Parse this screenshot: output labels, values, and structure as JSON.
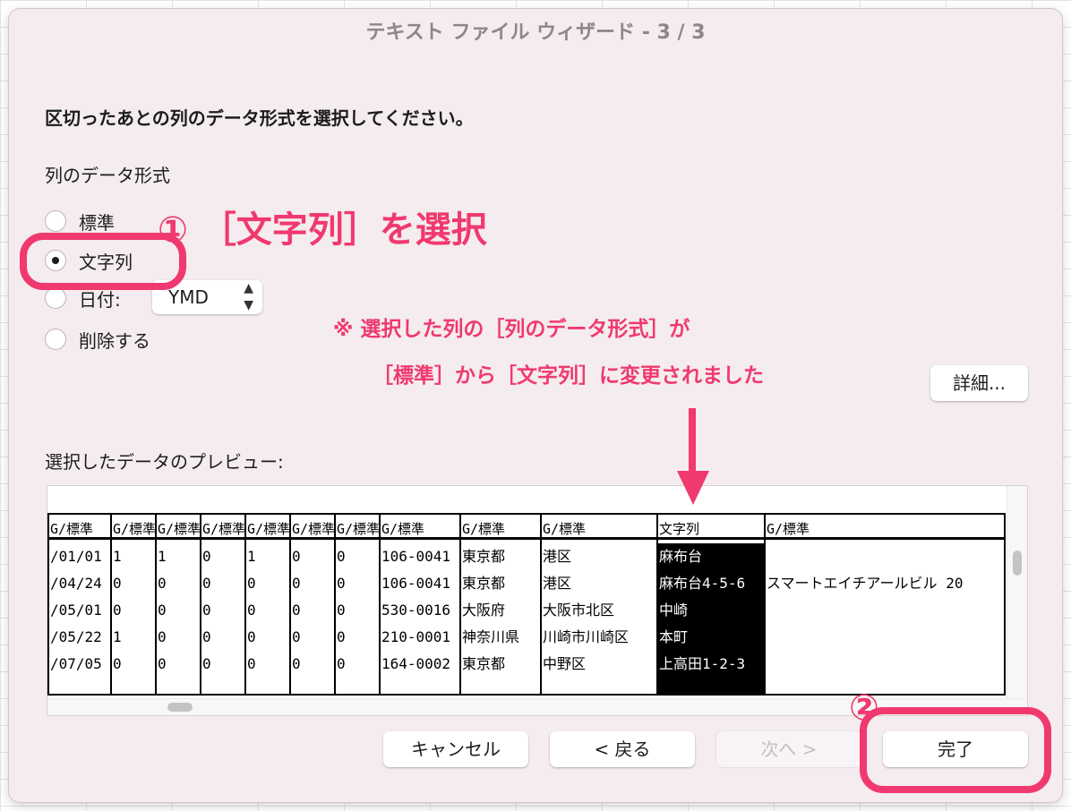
{
  "window": {
    "title": "テキスト ファイル ウィザード - 3 / 3"
  },
  "instruction": "区切ったあとの列のデータ形式を選択してください。",
  "column_format": {
    "label": "列のデータ形式",
    "options": [
      {
        "label": "標準",
        "selected": false
      },
      {
        "label": "文字列",
        "selected": true
      },
      {
        "label": "日付:",
        "selected": false
      },
      {
        "label": "削除する",
        "selected": false
      }
    ],
    "date_format": "YMD"
  },
  "advanced_button": "詳細...",
  "preview": {
    "label": "選択したデータのプレビュー:",
    "headers": [
      "G/標準",
      "G/標準",
      "G/標準",
      "G/標準",
      "G/標準",
      "G/標準",
      "G/標準",
      "G/標準",
      "G/標準",
      "G/標準",
      "文字列",
      "G/標準"
    ],
    "rows": [
      [
        "/01/01",
        "1",
        "1",
        "0",
        "1",
        "0",
        "0",
        "106-0041",
        "東京都",
        "港区",
        "麻布台",
        ""
      ],
      [
        "/04/24",
        "0",
        "0",
        "0",
        "0",
        "0",
        "0",
        "106-0041",
        "東京都",
        "港区",
        "麻布台4-5-6",
        "スマートエイチアールビル 20"
      ],
      [
        "/05/01",
        "0",
        "0",
        "0",
        "0",
        "0",
        "0",
        "530-0016",
        "大阪府",
        "大阪市北区",
        "中崎",
        ""
      ],
      [
        "/05/22",
        "1",
        "0",
        "0",
        "0",
        "0",
        "0",
        "210-0001",
        "神奈川県",
        "川崎市川崎区",
        "本町",
        ""
      ],
      [
        "/07/05",
        "0",
        "0",
        "0",
        "0",
        "0",
        "0",
        "164-0002",
        "東京都",
        "中野区",
        "上高田1-2-3",
        ""
      ]
    ],
    "selected_column": 10
  },
  "buttons": {
    "cancel": "キャンセル",
    "back": "< 戻る",
    "next": "次へ >",
    "finish": "完了"
  },
  "annotations": {
    "step1": "① ［文字列］を選択",
    "note_line1": "※ 選択した列の［列のデータ形式］が",
    "note_line2": "［標準］から［文字列］に変更されました",
    "step2": "②",
    "accent_color": "#f0396f"
  }
}
